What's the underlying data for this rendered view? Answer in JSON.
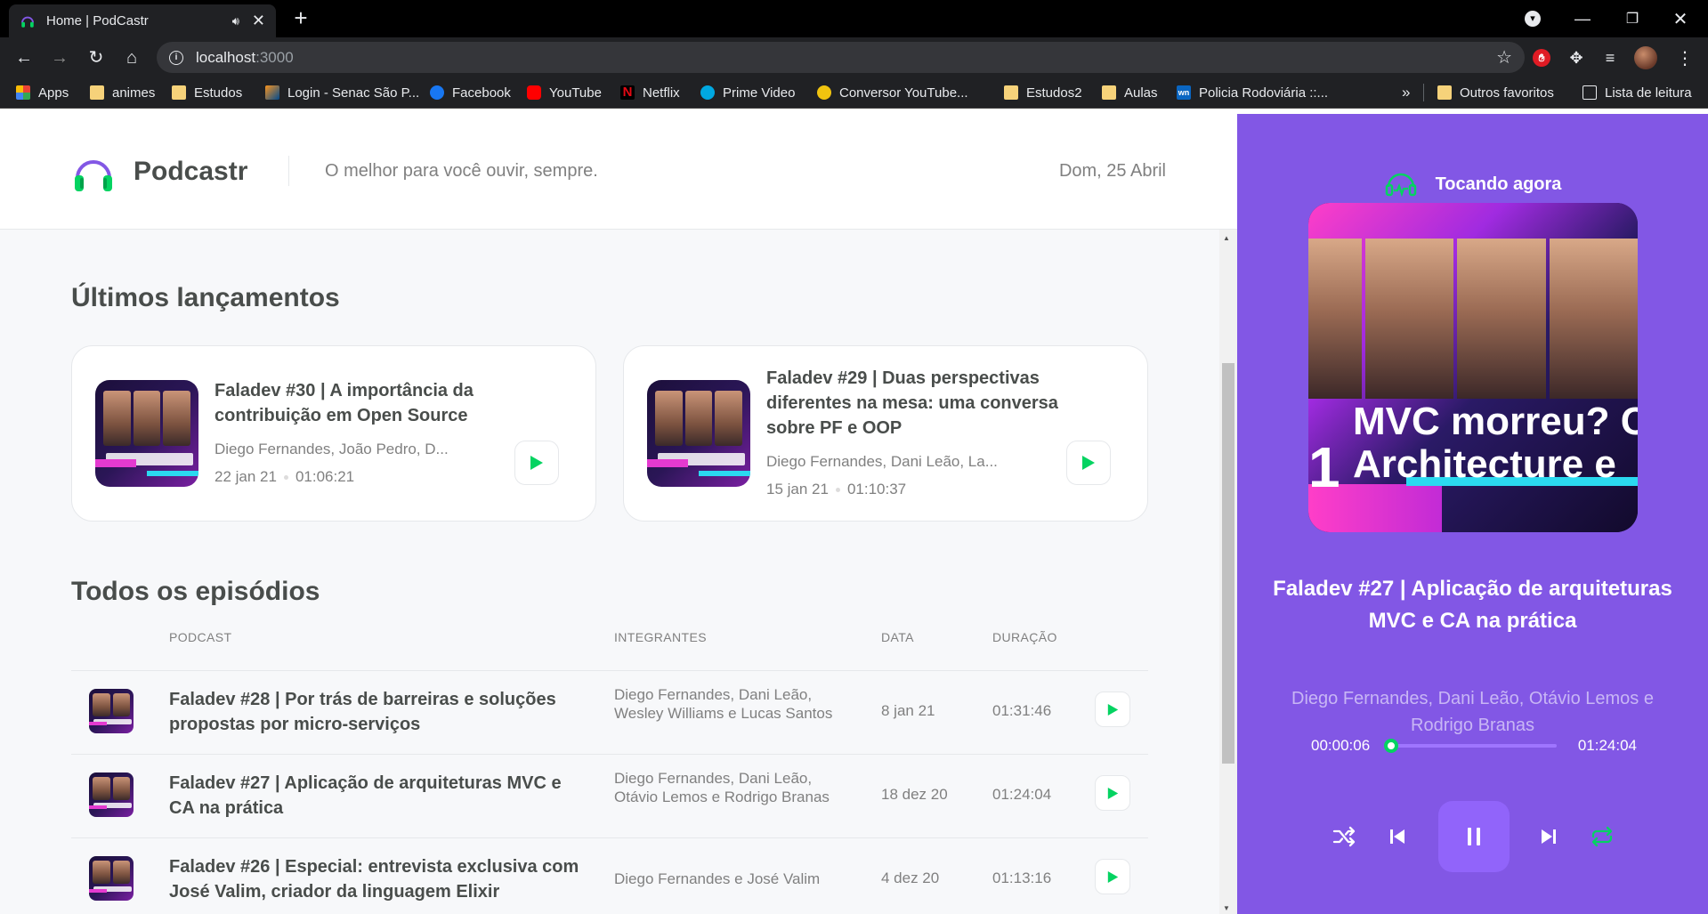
{
  "browser": {
    "tab_title": "Home | PodCastr",
    "url_host": "localhost",
    "url_port": ":3000",
    "bookmarks": [
      {
        "label": "Apps",
        "icon": "apps-grid-icon"
      },
      {
        "label": "animes",
        "icon": "folder-icon"
      },
      {
        "label": "Estudos",
        "icon": "folder-icon"
      },
      {
        "label": "Login - Senac São P...",
        "icon": "senac-icon"
      },
      {
        "label": "Facebook",
        "icon": "facebook-icon"
      },
      {
        "label": "YouTube",
        "icon": "youtube-icon"
      },
      {
        "label": "Netflix",
        "icon": "netflix-icon"
      },
      {
        "label": "Prime Video",
        "icon": "prime-video-icon"
      },
      {
        "label": "Conversor YouTube...",
        "icon": "converter-icon"
      },
      {
        "label": "Estudos2",
        "icon": "folder-icon"
      },
      {
        "label": "Aulas",
        "icon": "folder-icon"
      },
      {
        "label": "Policia Rodoviária ::...",
        "icon": "prf-icon"
      }
    ],
    "other_favorites": "Outros favoritos",
    "reading_list": "Lista de leitura",
    "netflix_glyph": "N",
    "prf_glyph": "wn"
  },
  "header": {
    "brand": "Podcastr",
    "tagline": "O melhor para você ouvir, sempre.",
    "date": "Dom, 25 Abril"
  },
  "latest": {
    "title": "Últimos lançamentos",
    "episodes": [
      {
        "title": "Faladev #30 | A importância da contribuição em Open Source",
        "members": "Diego Fernandes, João Pedro, D...",
        "date": "22 jan 21",
        "duration": "01:06:21"
      },
      {
        "title": "Faladev #29 | Duas perspectivas diferentes na mesa: uma conversa sobre PF e OOP",
        "members": "Diego Fernandes, Dani Leão, La...",
        "date": "15 jan 21",
        "duration": "01:10:37"
      }
    ]
  },
  "all": {
    "title": "Todos os episódios",
    "columns": {
      "podcast": "Podcast",
      "members": "Integrantes",
      "date": "Data",
      "duration": "Duração"
    },
    "episodes": [
      {
        "title": "Faladev #28 | Por trás de barreiras e soluções propostas por micro-serviços",
        "members": "Diego Fernandes, Dani Leão, Wesley Williams e Lucas Santos",
        "date": "8 jan 21",
        "duration": "01:31:46"
      },
      {
        "title": "Faladev #27 | Aplicação de arquiteturas MVC e CA na prática",
        "members": "Diego Fernandes, Dani Leão, Otávio Lemos e Rodrigo Branas",
        "date": "18 dez 20",
        "duration": "01:24:04"
      },
      {
        "title": "Faladev #26 | Especial: entrevista exclusiva com José Valim, criador da linguagem Elixir",
        "members": "Diego Fernandes e José Valim",
        "date": "4 dez 20",
        "duration": "01:13:16"
      }
    ]
  },
  "player": {
    "label": "Tocando agora",
    "cover_text_line1": "MVC morreu? C",
    "cover_text_line2": "Architecture e",
    "cover_number": "1",
    "title": "Faladev #27 | Aplicação de arquiteturas MVC e CA na prática",
    "members": "Diego Fernandes, Dani Leão, Otávio Lemos e Rodrigo Branas",
    "current_time": "00:00:06",
    "total_time": "01:24:04",
    "progress_fraction": 0.001,
    "is_playing": true
  },
  "colors": {
    "purple": "#8257e5",
    "purple_button": "#9164fa",
    "green": "#04d361",
    "text_dark": "#494d4b",
    "text_muted": "#808080"
  }
}
